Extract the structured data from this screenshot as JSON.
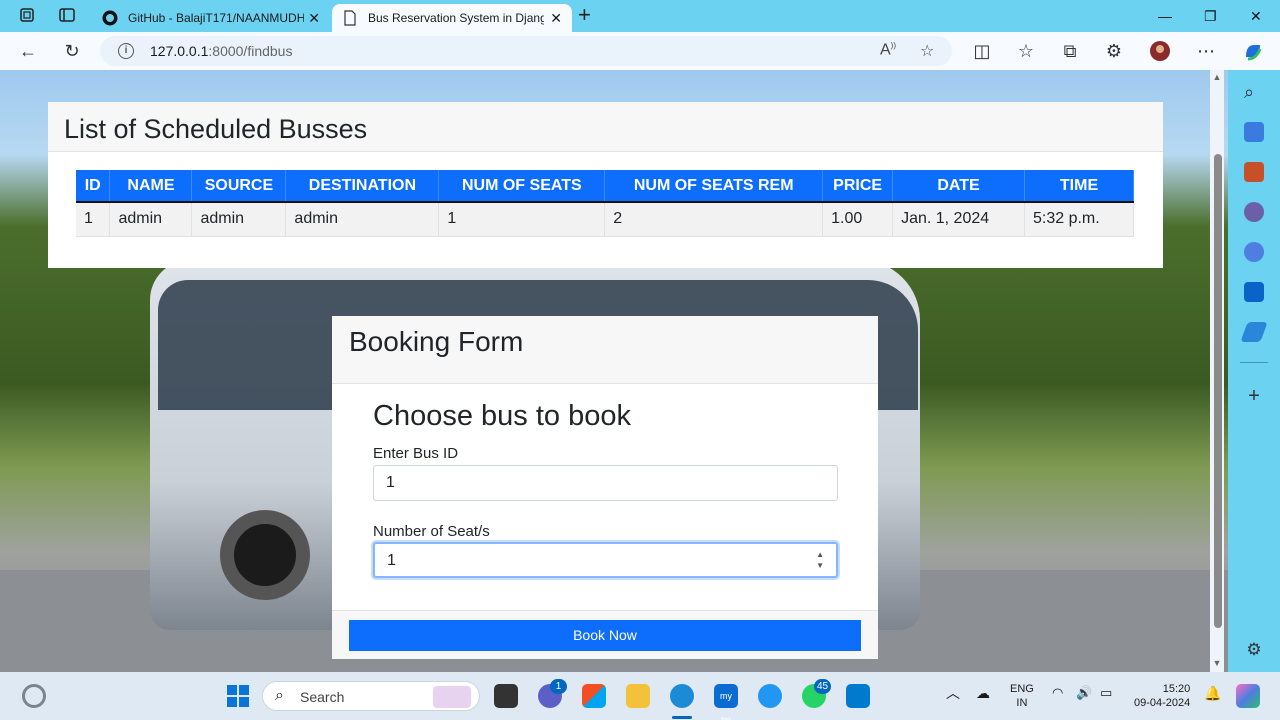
{
  "browser": {
    "tabs": [
      {
        "title": "GitHub - BalajiT171/NAANMUDH",
        "active": false
      },
      {
        "title": "Bus Reservation System in Djang",
        "active": true
      }
    ],
    "address": {
      "host": "127.0.0.1",
      "path": ":8000/findbus"
    }
  },
  "page": {
    "list_title": "List of Scheduled Busses",
    "table": {
      "headers": [
        "ID",
        "NAME",
        "SOURCE",
        "DESTINATION",
        "NUM OF SEATS",
        "NUM OF SEATS REM",
        "PRICE",
        "DATE",
        "TIME"
      ],
      "rows": [
        [
          "1",
          "admin",
          "admin",
          "admin",
          "1",
          "2",
          "1.00",
          "Jan. 1, 2024",
          "5:32 p.m."
        ]
      ]
    },
    "booking": {
      "header": "Booking Form",
      "title": "Choose bus to book",
      "bus_id_label": "Enter Bus ID",
      "bus_id_value": "1",
      "seats_label": "Number of Seat/s",
      "seats_value": "1",
      "submit_label": "Book Now"
    }
  },
  "taskbar": {
    "search_text": "Search",
    "teams_badge": "1",
    "whatsapp_badge": "45",
    "lang": "ENG",
    "region": "IN",
    "time": "15:20",
    "date": "09-04-2024"
  },
  "colors": {
    "primary": "#0d6efd",
    "chrome": "#6bd2f2"
  }
}
